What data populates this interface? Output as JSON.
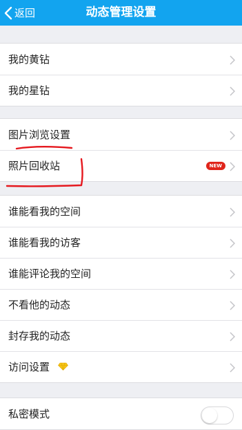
{
  "header": {
    "back_label": "返回",
    "title": "动态管理设置"
  },
  "sections": [
    {
      "rows": [
        {
          "label": "我的黄钻"
        },
        {
          "label": "我的星钻"
        }
      ]
    },
    {
      "rows": [
        {
          "label": "图片浏览设置"
        },
        {
          "label": "照片回收站",
          "badge": "NEW"
        }
      ]
    },
    {
      "rows": [
        {
          "label": "谁能看我的空间"
        },
        {
          "label": "谁能看我的访客"
        },
        {
          "label": "谁能评论我的空间"
        },
        {
          "label": "不看他的动态"
        },
        {
          "label": "封存我的动态"
        },
        {
          "label": "访问设置",
          "icon": "yellow-diamond-icon"
        }
      ]
    },
    {
      "rows": [
        {
          "label": "私密模式",
          "toggle": "off"
        }
      ]
    }
  ],
  "colors": {
    "header": "#12a4ef",
    "background": "#eeeff3",
    "badge": "#e0251b",
    "annotation": "#e5181e",
    "diamond": "#f5c518"
  }
}
